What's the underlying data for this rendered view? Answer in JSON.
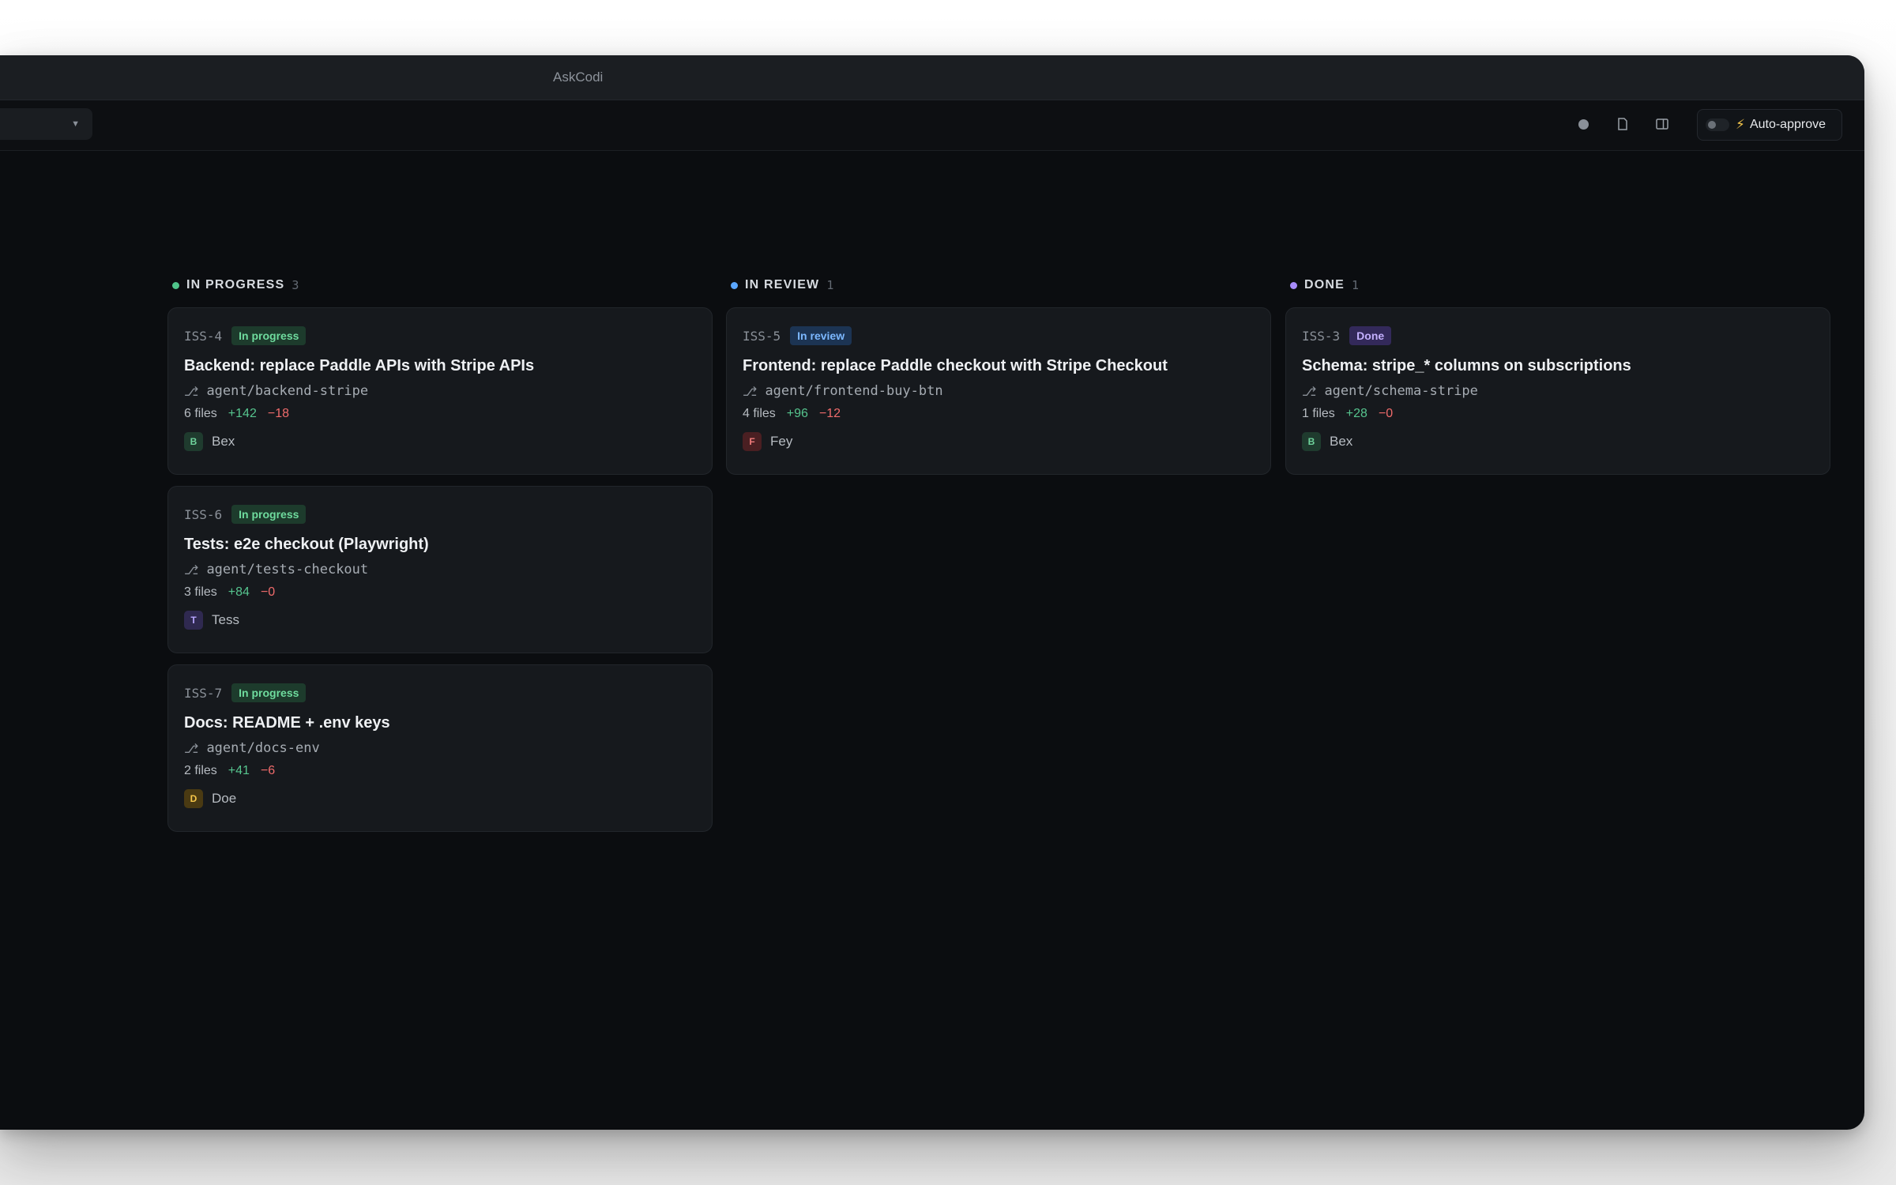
{
  "window": {
    "title": "AskCodi"
  },
  "toolbar": {
    "dropdown_value": "",
    "caret_icon": "chevron-down-icon",
    "icons": [
      "record-icon",
      "document-icon",
      "split-panel-icon"
    ],
    "auto_approve_label": "Auto-approve",
    "auto_approve_enabled": false,
    "bolt_icon": "lightning-icon"
  },
  "colors": {
    "in_progress": "#4fc48a",
    "in_review": "#5aa6ff",
    "done": "#a78bfa",
    "additions": "#56c48e",
    "deletions": "#ef6b6b"
  },
  "columns": [
    {
      "name": "IN PROGRESS",
      "count": "3",
      "cards": [
        {
          "issue": "ISS-4",
          "status": "In progress",
          "title": "Backend: replace Paddle APIs with Stripe APIs",
          "branch": "agent/backend-stripe",
          "files": "6 files",
          "additions": "+142",
          "deletions": "−18",
          "assignee": {
            "initial": "B",
            "name": "Bex"
          }
        },
        {
          "issue": "ISS-6",
          "status": "In progress",
          "title": "Tests: e2e checkout (Playwright)",
          "branch": "agent/tests-checkout",
          "files": "3 files",
          "additions": "+84",
          "deletions": "−0",
          "assignee": {
            "initial": "T",
            "name": "Tess"
          }
        },
        {
          "issue": "ISS-7",
          "status": "In progress",
          "title": "Docs: README + .env keys",
          "branch": "agent/docs-env",
          "files": "2 files",
          "additions": "+41",
          "deletions": "−6",
          "assignee": {
            "initial": "D",
            "name": "Doe"
          }
        }
      ]
    },
    {
      "name": "IN REVIEW",
      "count": "1",
      "cards": [
        {
          "issue": "ISS-5",
          "status": "In review",
          "title": "Frontend: replace Paddle checkout with Stripe Checkout",
          "branch": "agent/frontend-buy-btn",
          "files": "4 files",
          "additions": "+96",
          "deletions": "−12",
          "assignee": {
            "initial": "F",
            "name": "Fey"
          }
        }
      ]
    },
    {
      "name": "DONE",
      "count": "1",
      "cards": [
        {
          "issue": "ISS-3",
          "status": "Done",
          "title": "Schema: stripe_* columns on subscriptions",
          "branch": "agent/schema-stripe",
          "files": "1 files",
          "additions": "+28",
          "deletions": "−0",
          "assignee": {
            "initial": "B",
            "name": "Bex"
          }
        }
      ]
    }
  ]
}
